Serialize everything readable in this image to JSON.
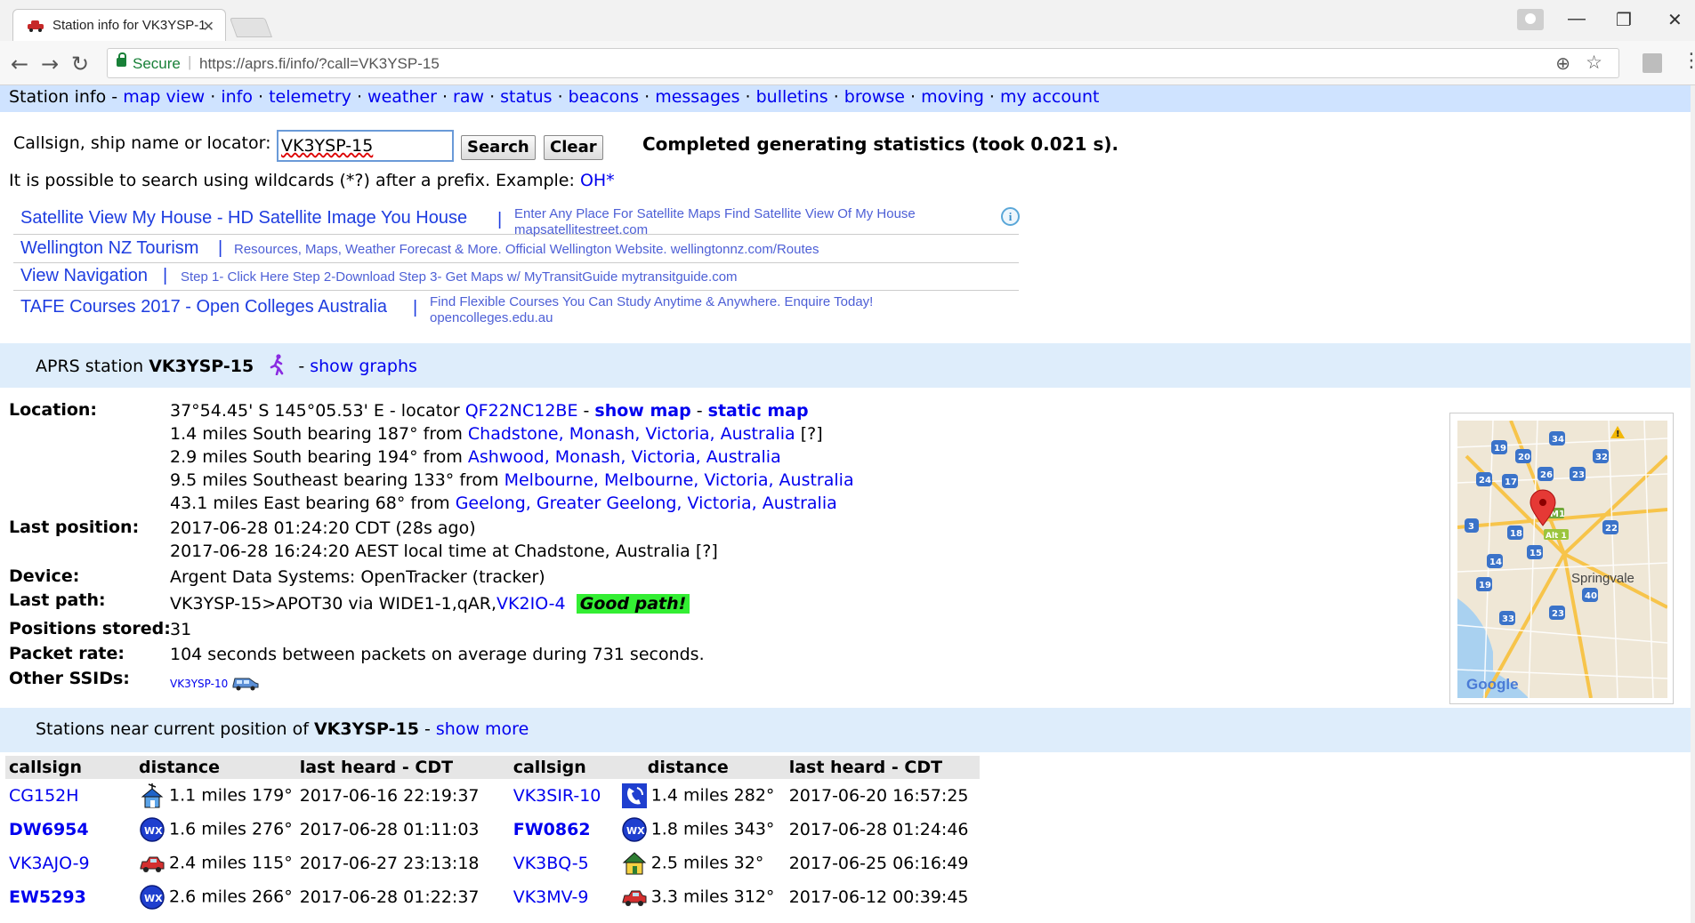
{
  "browser": {
    "tab_title": "Station info for VK3YSP-1",
    "secure_label": "Secure",
    "url": "https://aprs.fi/info/?call=VK3YSP-15"
  },
  "nav": {
    "current": "Station info",
    "links": [
      "map view",
      "info",
      "telemetry",
      "weather",
      "raw",
      "status",
      "beacons",
      "messages",
      "bulletins",
      "browse",
      "moving",
      "my account"
    ]
  },
  "search": {
    "label": "Callsign, ship name or locator:",
    "value": "VK3YSP-15",
    "search_button": "Search",
    "clear_button": "Clear",
    "status": "Completed generating statistics (took 0.021 s).",
    "wildcard_text": "It is possible to search using wildcards (*?) after a prefix. Example:",
    "wildcard_example": "OH*"
  },
  "ads": [
    {
      "title": "Satellite View My House - HD Satellite Image You House",
      "desc1": "Enter Any Place For Satellite Maps Find Satellite View Of My House",
      "desc2": "mapsatellitestreet.com"
    },
    {
      "title": "Wellington NZ Tourism",
      "desc1": "Resources, Maps, Weather Forecast & More. Official Wellington Website. wellingtonnz.com/Routes",
      "desc2": ""
    },
    {
      "title": "View Navigation",
      "desc1": "Step 1- Click Here Step 2-Download Step 3- Get Maps w/ MyTransitGuide mytransitguide.com",
      "desc2": ""
    },
    {
      "title": "TAFE Courses 2017 - Open Colleges Australia",
      "desc1": "Find Flexible Courses You Can Study Anytime & Anywhere. Enquire Today!",
      "desc2": "opencolleges.edu.au"
    }
  ],
  "station": {
    "header_prefix": "APRS station",
    "callsign": "VK3YSP-15",
    "show_graphs": "show graphs",
    "labels": {
      "location": "Location:",
      "last_position": "Last position:",
      "device": "Device:",
      "last_path": "Last path:",
      "positions_stored": "Positions stored:",
      "packet_rate": "Packet rate:",
      "other_ssids": "Other SSIDs:"
    },
    "location": {
      "coords": "37°54.45' S 145°05.53' E - locator",
      "locator": "QF22NC12BE",
      "show_map": "show map",
      "static_map": "static map",
      "nearby": [
        {
          "text": "1.4 miles South bearing 187° from",
          "place": "Chadstone, Monash, Victoria, Australia",
          "suffix": "[?]"
        },
        {
          "text": "2.9 miles South bearing 194° from",
          "place": "Ashwood, Monash, Victoria, Australia",
          "suffix": ""
        },
        {
          "text": "9.5 miles Southeast bearing 133° from",
          "place": "Melbourne, Melbourne, Victoria, Australia",
          "suffix": ""
        },
        {
          "text": "43.1 miles East bearing 68° from",
          "place": "Geelong, Greater Geelong, Victoria, Australia",
          "suffix": ""
        }
      ]
    },
    "last_position": [
      "2017-06-28 01:24:20 CDT (28s ago)",
      "2017-06-28 16:24:20 AEST local time at Chadstone, Australia [?]"
    ],
    "device": "Argent Data Systems: OpenTracker (tracker)",
    "last_path_text": "VK3YSP-15>APOT30 via WIDE1-1,qAR,",
    "last_path_link": "VK2IO-4",
    "good_path": "Good path!",
    "positions_stored": "31",
    "packet_rate": "104 seconds between packets on average during 731 seconds.",
    "other_ssid": "VK3YSP-10"
  },
  "map": {
    "place": "Springvale",
    "logo": "Google",
    "route_labels": [
      "19",
      "34",
      "20",
      "32",
      "26",
      "23",
      "24",
      "17",
      "M1",
      "3",
      "18",
      "Alt 1",
      "22",
      "15",
      "14",
      "19",
      "40",
      "33",
      "23"
    ]
  },
  "nearby": {
    "prefix": "Stations near current position of",
    "callsign": "VK3YSP-15",
    "show_more": "show more",
    "headers": [
      "callsign",
      "distance",
      "last heard - CDT",
      "callsign",
      "distance",
      "last heard - CDT"
    ],
    "rows": [
      [
        {
          "call": "CG152H",
          "bold": false,
          "icon": "house-antenna-icon",
          "dist": "1.1 miles 179°",
          "heard": "2017-06-16 22:19:37"
        },
        {
          "call": "VK3SIR-10",
          "bold": false,
          "icon": "phone-icon",
          "dist": "1.4 miles 282°",
          "heard": "2017-06-20 16:57:25"
        }
      ],
      [
        {
          "call": "DW6954",
          "bold": true,
          "icon": "wx-icon",
          "dist": "1.6 miles 276°",
          "heard": "2017-06-28 01:11:03"
        },
        {
          "call": "FW0862",
          "bold": true,
          "icon": "wx-icon",
          "dist": "1.8 miles 343°",
          "heard": "2017-06-28 01:24:46"
        }
      ],
      [
        {
          "call": "VK3AJO-9",
          "bold": false,
          "icon": "car-icon",
          "dist": "2.4 miles 115°",
          "heard": "2017-06-27 23:13:18"
        },
        {
          "call": "VK3BQ-5",
          "bold": false,
          "icon": "house-icon",
          "dist": "2.5 miles 32°",
          "heard": "2017-06-25 06:16:49"
        }
      ],
      [
        {
          "call": "EW5293",
          "bold": true,
          "icon": "wx-icon",
          "dist": "2.6 miles 266°",
          "heard": "2017-06-28 01:22:37"
        },
        {
          "call": "VK3MV-9",
          "bold": false,
          "icon": "car-icon",
          "dist": "3.3 miles 312°",
          "heard": "2017-06-12 00:39:45"
        }
      ]
    ]
  }
}
